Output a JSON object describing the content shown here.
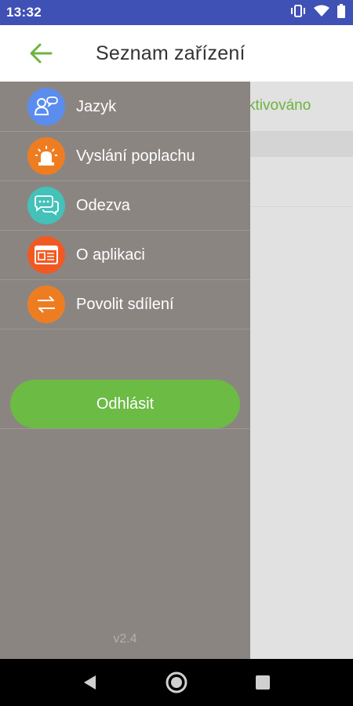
{
  "status_bar": {
    "time": "13:32",
    "icons": [
      "vibrate-icon",
      "wifi-icon",
      "battery-icon"
    ]
  },
  "header": {
    "title": "Seznam zařízení",
    "back_icon": "arrow-left-icon",
    "accent_color": "#6db33f"
  },
  "content": {
    "status_text": "ktivováno"
  },
  "drawer": {
    "items": [
      {
        "label": "Jazyk",
        "icon": "language-icon",
        "color": "#5b8def"
      },
      {
        "label": "Vyslání poplachu",
        "icon": "alarm-siren-icon",
        "color": "#ee7d22"
      },
      {
        "label": "Odezva",
        "icon": "chat-bubbles-icon",
        "color": "#44c1b9"
      },
      {
        "label": "O aplikaci",
        "icon": "info-document-icon",
        "color": "#f05a22"
      },
      {
        "label": "Povolit sdílení",
        "icon": "share-arrows-icon",
        "color": "#ee7d22"
      }
    ],
    "logout_label": "Odhlásit",
    "logout_color": "#6bbb45",
    "version": "v2.4"
  },
  "nav_bar": {
    "buttons": [
      "back-triangle-icon",
      "home-circle-icon",
      "recents-square-icon"
    ]
  }
}
